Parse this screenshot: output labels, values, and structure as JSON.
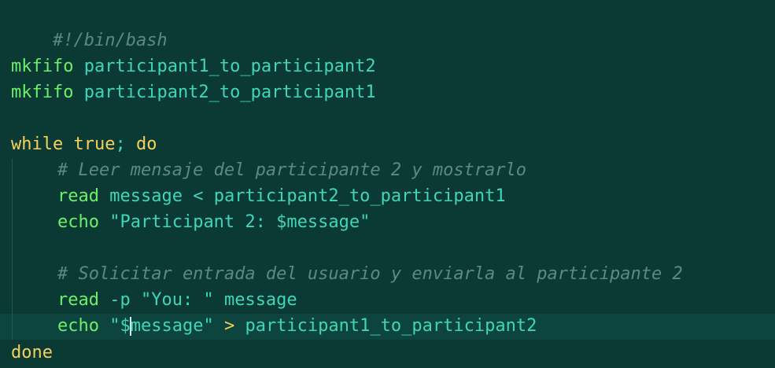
{
  "editor": {
    "language": "bash",
    "shebang": "#!/bin/bash",
    "mkfifo1": {
      "cmd": "mkfifo",
      "arg": "participant1_to_participant2"
    },
    "mkfifo2": {
      "cmd": "mkfifo",
      "arg": "participant2_to_participant1"
    },
    "while_line": {
      "kw_while": "while",
      "kw_true": "true",
      "semi": ";",
      "kw_do": "do"
    },
    "comment1": "# Leer mensaje del participante 2 y mostrarlo",
    "read1": {
      "cmd": "read",
      "var": "message",
      "op": "<",
      "src": "participant2_to_participant1"
    },
    "echo1": {
      "cmd": "echo",
      "str": "\"Participant 2: $message\""
    },
    "comment2": "# Solicitar entrada del usuario y enviarla al participante 2",
    "read2": {
      "cmd": "read",
      "flag": "-p",
      "str": "\"You: \"",
      "var": "message"
    },
    "echo2": {
      "cmd": "echo",
      "str_before_cursor": "\"$",
      "str_after_cursor": "message\"",
      "op": ">",
      "dest": "participant1_to_participant2"
    },
    "done_kw": "done"
  },
  "colors": {
    "background": "#0b3a35",
    "current_line": "#0e443e",
    "comment": "#5b8a84",
    "command": "#6af06a",
    "text": "#3fd6b8",
    "keyword": "#f4d15a"
  }
}
